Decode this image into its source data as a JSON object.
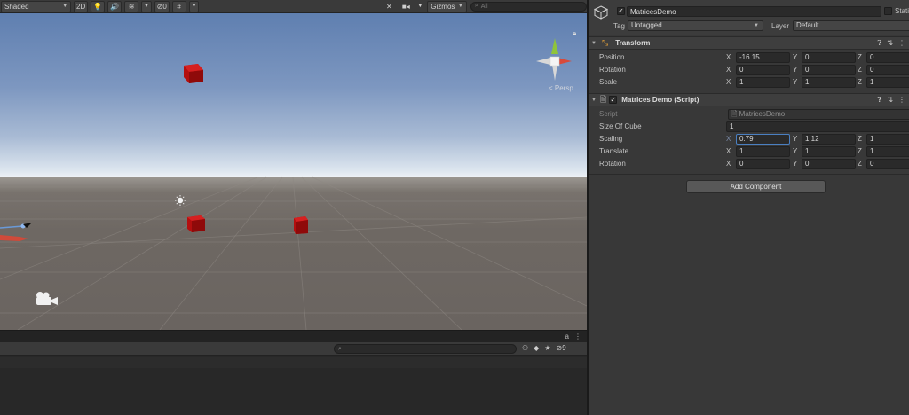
{
  "scene_toolbar": {
    "shading_mode": "Shaded",
    "mode_2d": "2D",
    "hidden_count": "0",
    "gizmos_label": "Gizmos",
    "search_placeholder": "All"
  },
  "scene": {
    "persp_label": "< Persp"
  },
  "bottom": {
    "hidden_count": "9"
  },
  "inspector": {
    "object_name": "MatricesDemo",
    "static_label": "Stati",
    "tag_label": "Tag",
    "tag_value": "Untagged",
    "layer_label": "Layer",
    "layer_value": "Default",
    "transform": {
      "title": "Transform",
      "rows": [
        {
          "label": "Position",
          "x": "-16.15",
          "y": "0",
          "z": "0"
        },
        {
          "label": "Rotation",
          "x": "0",
          "y": "0",
          "z": "0"
        },
        {
          "label": "Scale",
          "x": "1",
          "y": "1",
          "z": "1"
        }
      ]
    },
    "script_component": {
      "title": "Matrices Demo (Script)",
      "script_label": "Script",
      "script_value": "MatricesDemo",
      "size_label": "Size Of Cube",
      "size_value": "1",
      "rows": [
        {
          "label": "Scaling",
          "x": "0.79",
          "y": "1.12",
          "z": "1"
        },
        {
          "label": "Translate",
          "x": "1",
          "y": "1",
          "z": "1"
        },
        {
          "label": "Rotation",
          "x": "0",
          "y": "0",
          "z": "0"
        }
      ]
    },
    "axis_labels": {
      "x": "X",
      "y": "Y",
      "z": "Z"
    },
    "add_component_label": "Add Component"
  },
  "colors": {
    "cube_red": "#c81414",
    "sky_top": "#5f7fb0",
    "ground": "#6e6863",
    "panel": "#383838"
  }
}
